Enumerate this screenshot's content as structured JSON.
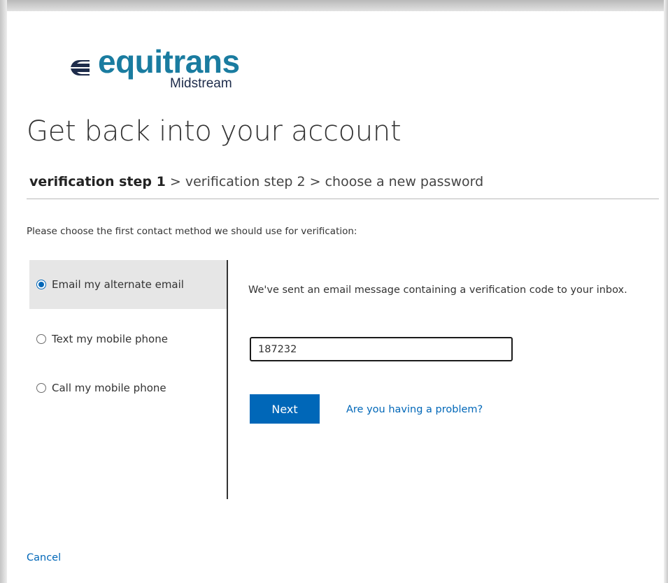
{
  "brand": {
    "logo_text": "equitrans",
    "logo_subtext": "Midstream",
    "colors": {
      "logo_teal": "#1a7ca0",
      "logo_navy": "#1d2b4a"
    }
  },
  "page": {
    "title": "Get back into your account"
  },
  "breadcrumb": {
    "steps": [
      "verification step 1",
      "verification step 2",
      "choose a new password"
    ],
    "separator": " > ",
    "active_index": 0
  },
  "instruction": "Please choose the first contact method we should use for verification:",
  "methods": [
    {
      "label": "Email my alternate email",
      "selected": true
    },
    {
      "label": "Text my mobile phone",
      "selected": false
    },
    {
      "label": "Call my mobile phone",
      "selected": false
    }
  ],
  "email_panel": {
    "message": "We've sent an email message containing a verification code to your inbox.",
    "code_value": "187232",
    "next_label": "Next",
    "problem_link": "Are you having a problem?"
  },
  "cancel_label": "Cancel",
  "colors": {
    "accent": "#0067b8",
    "selected_bg": "#e6e6e6"
  },
  "icons": [
    "equitrans-logo-mark-icon",
    "radio-checked-icon",
    "radio-unchecked-icon"
  ]
}
